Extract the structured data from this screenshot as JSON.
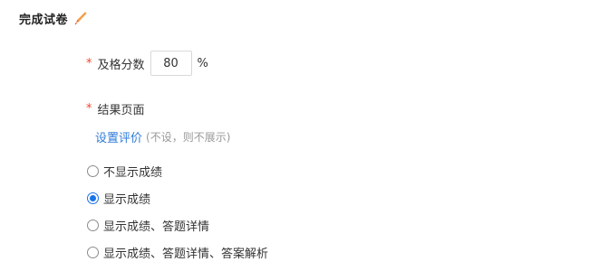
{
  "section": {
    "title": "完成试卷",
    "edit_icon": "pencil-icon",
    "edit_icon_color": "#f08a24"
  },
  "pass_score": {
    "required_mark": "*",
    "label": "及格分数",
    "value": "80",
    "unit": "%"
  },
  "result_page": {
    "required_mark": "*",
    "label": "结果页面",
    "set_eval_link": "设置评价",
    "set_eval_hint": "(不设，则不展示)",
    "selected_index": 1,
    "options": [
      {
        "label": "不显示成绩",
        "checked": false
      },
      {
        "label": "显示成绩",
        "checked": true
      },
      {
        "label": "显示成绩、答题详情",
        "checked": false
      },
      {
        "label": "显示成绩、答题详情、答案解析",
        "checked": false
      }
    ]
  },
  "colors": {
    "required_star": "#f0452b",
    "link": "#2f7bd8",
    "radio_checked": "#1a73e8",
    "hint": "#999999"
  }
}
